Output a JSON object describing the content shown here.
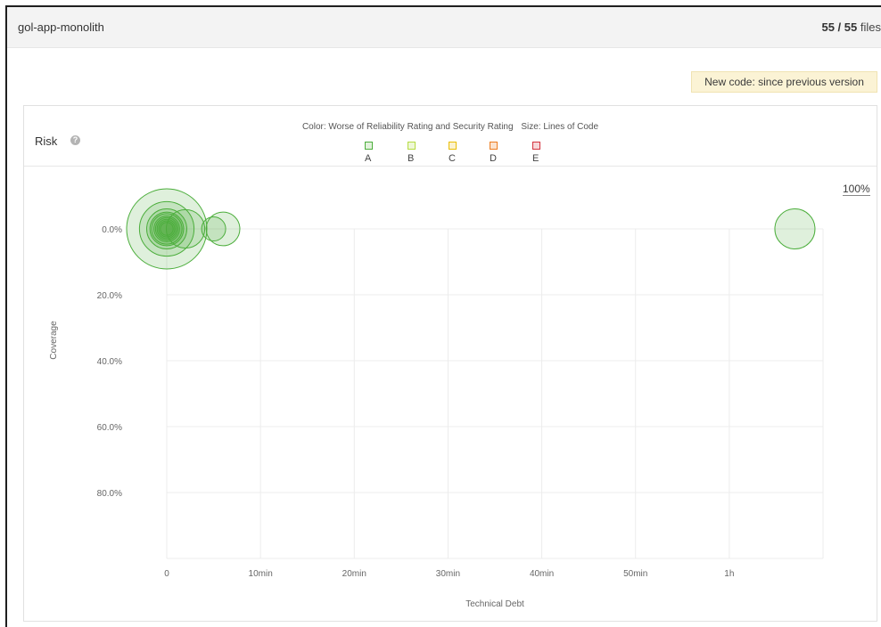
{
  "project": {
    "name": "gol-app-monolith",
    "files_shown": "55 / 55",
    "files_suffix": "files"
  },
  "new_code_label": "New code: since previous version",
  "panel": {
    "title": "Risk",
    "help_icon": "help-icon",
    "color_label": "Color: Worse of Reliability Rating and Security Rating",
    "size_label": "Size: Lines of Code",
    "legend": [
      {
        "label": "A",
        "color": "#4cae3c",
        "fill": "#e2f1dc"
      },
      {
        "label": "B",
        "color": "#b5dc42",
        "fill": "#eef7d7"
      },
      {
        "label": "C",
        "color": "#eabe06",
        "fill": "#fbf2cf"
      },
      {
        "label": "D",
        "color": "#ed7d20",
        "fill": "#fbe3cf"
      },
      {
        "label": "E",
        "color": "#d4333f",
        "fill": "#f6d6d8"
      }
    ],
    "zoom_label": "100%"
  },
  "chart_data": {
    "type": "scatter",
    "xlabel": "Technical Debt",
    "ylabel": "Coverage",
    "x_unit": "minutes",
    "x_ticks": [
      {
        "value": 0,
        "label": "0"
      },
      {
        "value": 10,
        "label": "10min"
      },
      {
        "value": 20,
        "label": "20min"
      },
      {
        "value": 30,
        "label": "30min"
      },
      {
        "value": 40,
        "label": "40min"
      },
      {
        "value": 50,
        "label": "50min"
      },
      {
        "value": 60,
        "label": "1h"
      }
    ],
    "y_ticks": [
      {
        "value": 0,
        "label": "0.0%"
      },
      {
        "value": 20,
        "label": "20.0%"
      },
      {
        "value": 40,
        "label": "40.0%"
      },
      {
        "value": 60,
        "label": "60.0%"
      },
      {
        "value": 80,
        "label": "80.0%"
      }
    ],
    "xlim": [
      0,
      70
    ],
    "ylim": [
      0,
      100
    ],
    "y_inverted": true,
    "grid": true,
    "series": [
      {
        "rating": "A",
        "points": [
          {
            "x": 0,
            "y": 0,
            "size": 1.0
          },
          {
            "x": 0,
            "y": 0,
            "size": 0.68
          },
          {
            "x": 0,
            "y": 0,
            "size": 0.5
          },
          {
            "x": 0,
            "y": 0,
            "size": 0.42
          },
          {
            "x": 0,
            "y": 0,
            "size": 0.38
          },
          {
            "x": 0,
            "y": 0,
            "size": 0.32
          },
          {
            "x": 0,
            "y": 0,
            "size": 0.28
          },
          {
            "x": 0,
            "y": 0,
            "size": 0.24
          },
          {
            "x": 0,
            "y": 0,
            "size": 0.2
          },
          {
            "x": 0,
            "y": 0,
            "size": 0.16
          },
          {
            "x": 2,
            "y": 0,
            "size": 0.48
          },
          {
            "x": 5,
            "y": 0,
            "size": 0.3
          },
          {
            "x": 6,
            "y": 0,
            "size": 0.42
          },
          {
            "x": 67,
            "y": 0,
            "size": 0.5
          }
        ]
      }
    ]
  }
}
